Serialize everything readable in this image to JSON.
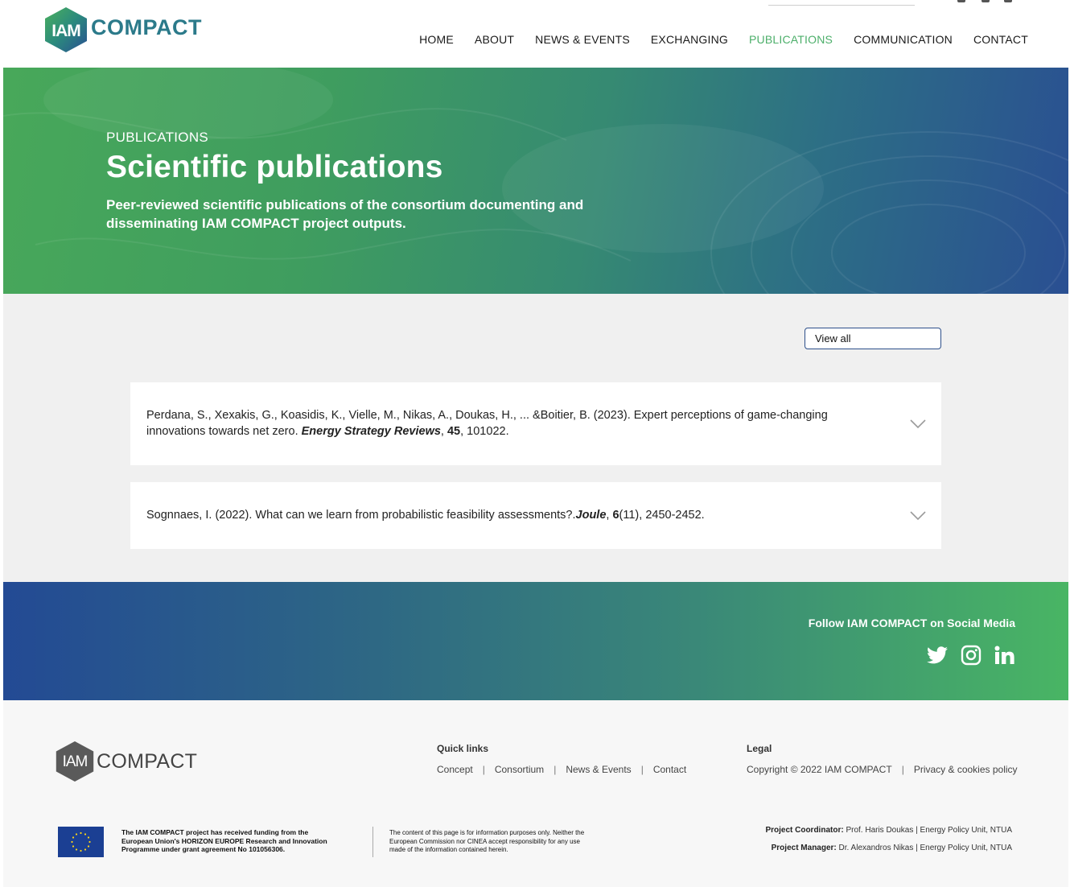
{
  "header": {
    "logo_mark": "IAM",
    "logo_word": "COMPACT",
    "nav": [
      {
        "label": "HOME"
      },
      {
        "label": "ABOUT"
      },
      {
        "label": "NEWS & EVENTS"
      },
      {
        "label": "EXCHANGING"
      },
      {
        "label": "PUBLICATIONS",
        "active": true
      },
      {
        "label": "COMMUNICATION"
      },
      {
        "label": "CONTACT"
      }
    ],
    "active_color": "#4caf6a"
  },
  "hero": {
    "kicker": "PUBLICATIONS",
    "title": "Scientific publications",
    "subtitle": "Peer-reviewed scientific publications of the consortium documenting and disseminating IAM COMPACT project outputs."
  },
  "filter": {
    "view_all": "View all"
  },
  "publications": [
    {
      "authors": "Perdana, S., Xexakis, G., Koasidis, K., Vielle, M., Nikas, A., Doukas, H., ... &Boitier, B. (2023). Expert perceptions of game-changing innovations towards net zero. ",
      "journal": "Energy Strategy Reviews",
      "volume_pre": ", ",
      "volume": "45",
      "rest": ", 101022."
    },
    {
      "authors": "Sognnaes, I. (2022). What can we learn from probabilistic feasibility assessments?.",
      "journal": "Joule",
      "volume_pre": ", ",
      "volume": "6",
      "rest": "(11), 2450-2452."
    }
  ],
  "social": {
    "title": "Follow IAM COMPACT on Social Media",
    "icons": [
      "twitter-icon",
      "instagram-icon",
      "linkedin-icon"
    ]
  },
  "footer": {
    "logo_mark": "IAM",
    "logo_word": "COMPACT",
    "quick_links_title": "Quick links",
    "quick_links": [
      "Concept",
      "Consortium",
      "News & Events",
      "Contact"
    ],
    "legal_title": "Legal",
    "legal_links": [
      "Copyright © 2022 IAM COMPACT",
      "Privacy & cookies policy"
    ],
    "funding_lines": [
      "The IAM COMPACT project has received funding from the",
      "European Union's HORIZON EUROPE Research and Innovation",
      "Programme under grant agreement No 101056306."
    ],
    "disclaimer_lines": [
      "The content of this page is for information purposes only. Neither the",
      "European Commission nor CINEA accept responsibility for any use",
      "made of the information contained herein."
    ],
    "coordinator_label": "Project Coordinator:",
    "coordinator_value": " Prof. Haris Doukas | Energy Policy Unit, NTUA",
    "manager_label": "Project Manager:",
    "manager_value": " Dr. Alexandros Nikas | Energy Policy Unit, NTUA"
  }
}
